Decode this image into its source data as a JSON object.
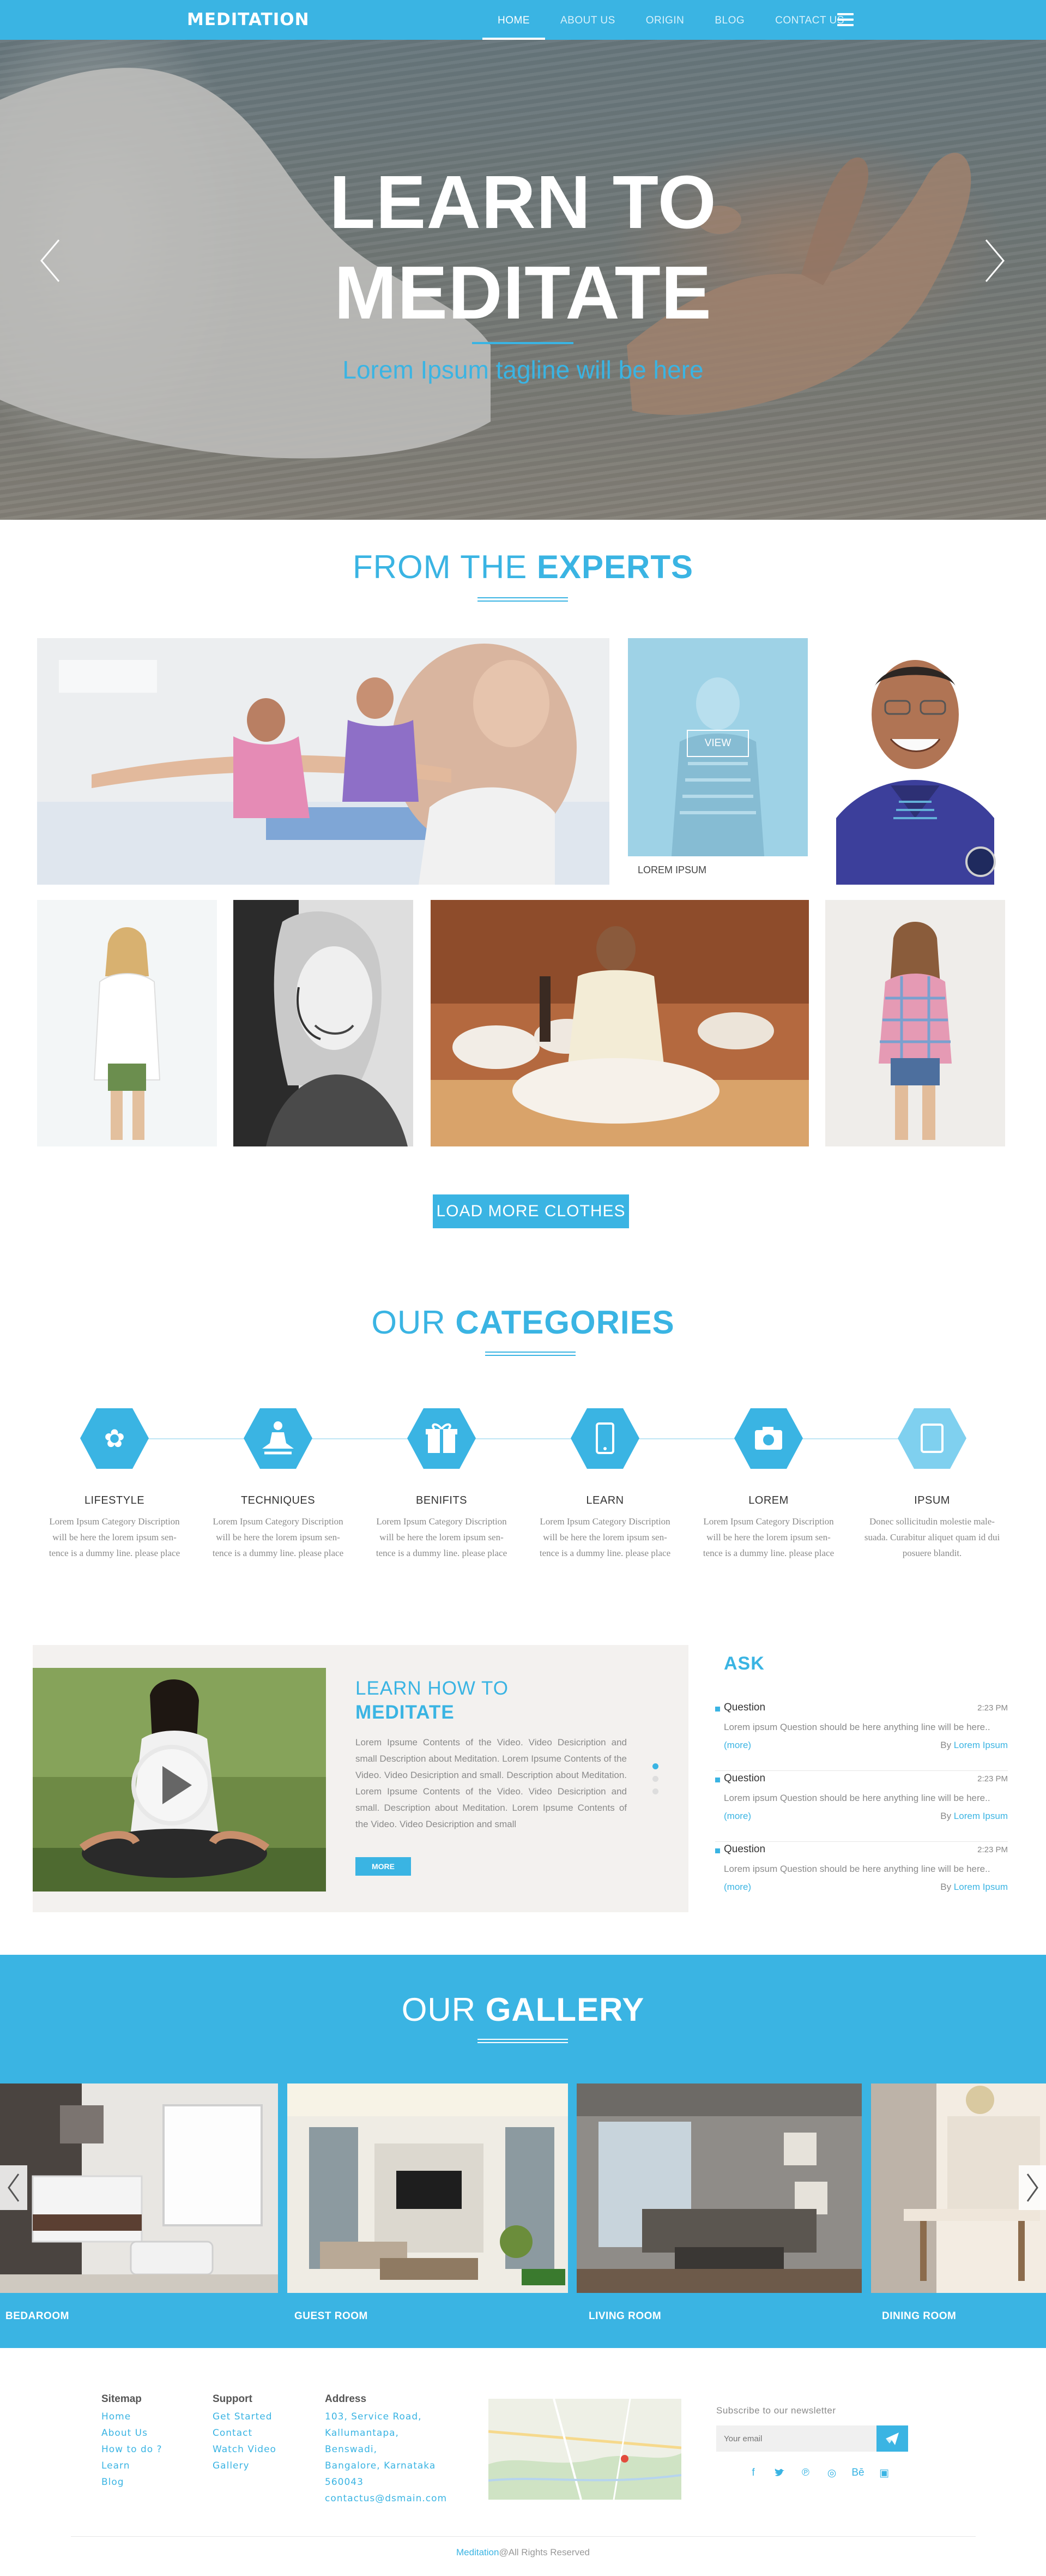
{
  "nav": {
    "logo": "MEDITATION",
    "links": [
      "HOME",
      "ABOUT US",
      "ORIGIN",
      "BLOG",
      "CONTACT US"
    ],
    "active_index": 0,
    "menu_icon": "hamburger-menu-icon"
  },
  "hero": {
    "title_line1": "LEARN TO",
    "title_line2": "MEDITATE",
    "tagline": "Lorem Ipsum tagline will be here",
    "prev_icon": "chevron-left-icon",
    "next_icon": "chevron-right-icon"
  },
  "experts": {
    "heading_light": "FROM THE ",
    "heading_bold": "EXPERTS",
    "view_label": "VIEW",
    "caption": "LOREM IPSUM",
    "load_more": "LOAD MORE CLOTHES"
  },
  "categories": {
    "heading_light": "OUR ",
    "heading_bold": "CATEGORIES",
    "items": [
      {
        "title": "LIFESTYLE",
        "icon": "lifestyle-icon",
        "lines": [
          "Lorem Ipsum Category Discription",
          "will be here the lorem ipsum sen-",
          "tence is a dummy line. please place"
        ]
      },
      {
        "title": "TECHNIQUES",
        "icon": "meditation-pose-icon",
        "lines": [
          "Lorem Ipsum Category Discription",
          "will be here the lorem ipsum sen-",
          "tence is a dummy line. please place"
        ]
      },
      {
        "title": "BENIFITS",
        "icon": "gift-icon",
        "lines": [
          "Lorem Ipsum Category Discription",
          "will be here the lorem ipsum sen-",
          "tence is a dummy line. please place"
        ]
      },
      {
        "title": "LEARN",
        "icon": "mobile-icon",
        "lines": [
          "Lorem Ipsum Category Discription",
          "will be here the lorem ipsum sen-",
          "tence is a dummy line. please place"
        ]
      },
      {
        "title": "LOREM",
        "icon": "camera-icon",
        "lines": [
          "Lorem Ipsum Category Discription",
          "will be here the lorem ipsum sen-",
          "tence is a dummy line. please place"
        ]
      },
      {
        "title": "IPSUM",
        "icon": "tablet-icon",
        "lines": [
          "Donec sollicitudin molestie male-",
          "suada. Curabitur aliquet quam id dui",
          "posuere blandit."
        ]
      }
    ]
  },
  "video": {
    "title_small": "LEARN HOW TO",
    "title_big": "MEDITATE",
    "body": "Lorem Ipsume Contents of the Video. Video Desicription and small Description about Meditation. Lorem Ipsume Contents of the Video. Video Desicription and small. Description about Meditation. Lorem Ipsume Contents of the Video. Video Desicription and small. Description about Meditation. Lorem Ipsume Contents of the Video. Video Desicription and small",
    "more_label": "MORE",
    "play_icon": "play-icon"
  },
  "ask": {
    "heading": "ASK",
    "questions": [
      {
        "label": "Question",
        "time": "2:23 PM",
        "text": "Lorem ipsum Question should be here anything line will be here..",
        "more": "(more)",
        "by_prefix": "By ",
        "by_name": "Lorem Ipsum"
      },
      {
        "label": "Question",
        "time": "2:23 PM",
        "text": "Lorem ipsum Question should be here anything line will be here..",
        "more": "(more)",
        "by_prefix": "By ",
        "by_name": "Lorem Ipsum"
      },
      {
        "label": "Question",
        "time": "2:23 PM",
        "text": "Lorem ipsum Question should be here anything line will be here..",
        "more": "(more)",
        "by_prefix": "By ",
        "by_name": "Lorem Ipsum"
      }
    ]
  },
  "gallery": {
    "heading_light": "OUR ",
    "heading_bold": "GALLERY",
    "labels": [
      "BEDAROOM",
      "GUEST ROOM",
      "LIVING ROOM",
      "DINING ROOM"
    ]
  },
  "footer": {
    "sitemap_head": "Sitemap",
    "sitemap_items": [
      "Home",
      "About Us",
      "How to do ?",
      "Learn",
      "Blog"
    ],
    "support_head": "Support",
    "support_items": [
      "Get Started",
      "Contact",
      "Watch Video",
      "Gallery"
    ],
    "address_head": "Address",
    "address_lines": [
      "103, Service Road,",
      "Kallumantapa,",
      "Benswadi,",
      "Bangalore, Karnataka",
      "560043",
      "contactus@dsmain.com"
    ],
    "newsletter_label": "Subscribe to our newsletter",
    "email_placeholder": "Your email",
    "send_icon": "paper-plane-icon",
    "social_icons": [
      "facebook-icon",
      "twitter-icon",
      "pinterest-icon",
      "dribbble-icon",
      "behance-icon",
      "instagram-icon"
    ],
    "copyright_brand": "Meditation",
    "copyright_rest": "@All Rights Reserved"
  },
  "colors": {
    "accent": "#3ab4e3",
    "text": "#444444",
    "muted": "#8a8a8a",
    "panel": "#f3f1ef"
  }
}
